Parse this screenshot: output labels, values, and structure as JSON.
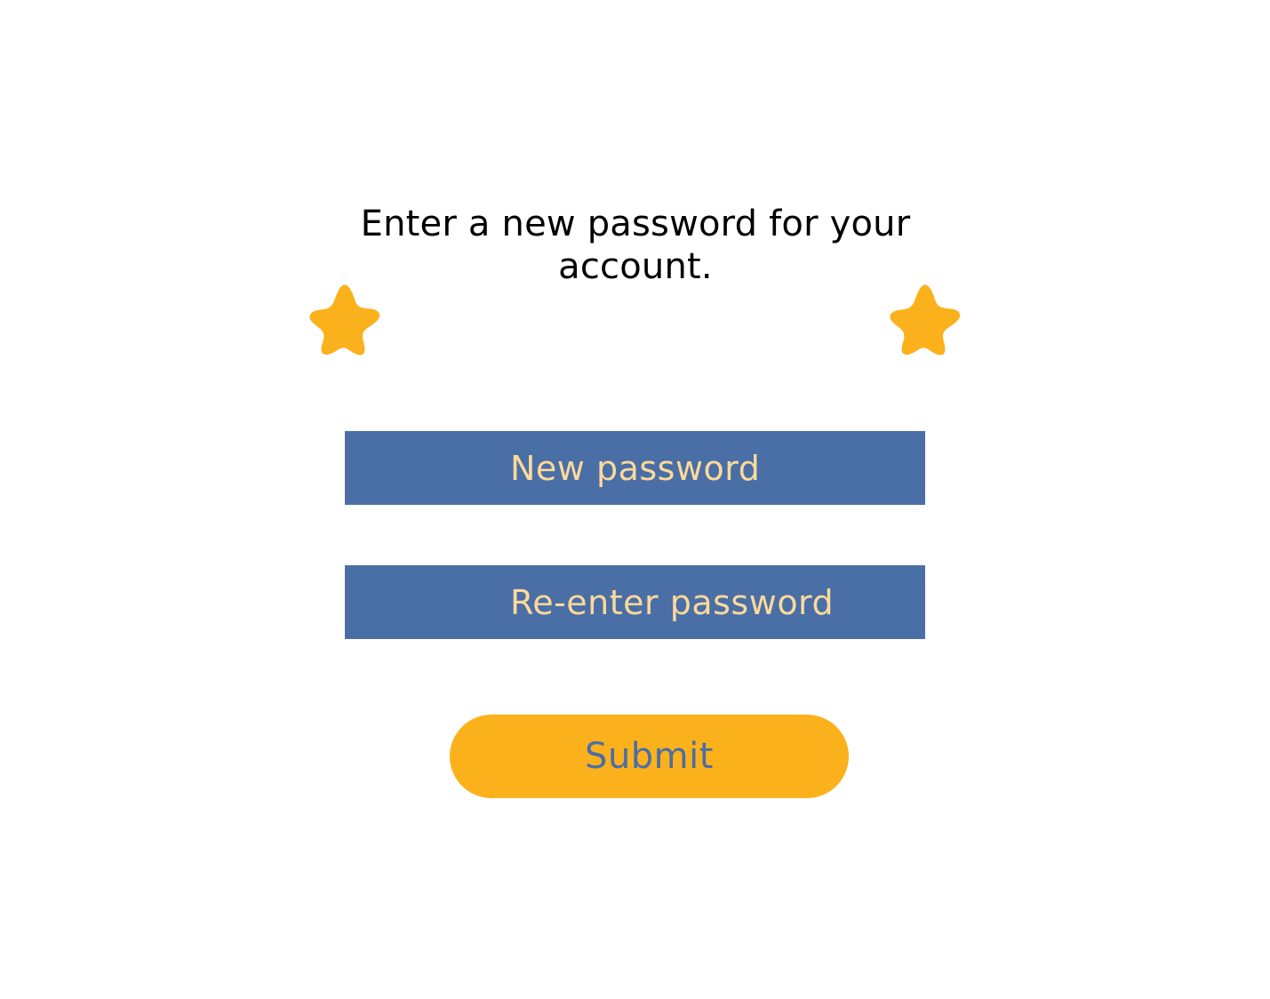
{
  "form": {
    "heading": "Enter a new password for your account.",
    "new_password": {
      "placeholder": "New password",
      "value": ""
    },
    "confirm_password": {
      "placeholder": "Re-enter password",
      "value": ""
    },
    "submit_label": "Submit"
  },
  "decorations": {
    "left_icon": "star-icon",
    "right_icon": "star-icon"
  },
  "colors": {
    "background": "#ffffff",
    "heading_text": "#000000",
    "field_background": "#4a6ea6",
    "field_text": "#fbd99a",
    "accent": "#fbb11b",
    "submit_text": "#4a6ea6"
  }
}
